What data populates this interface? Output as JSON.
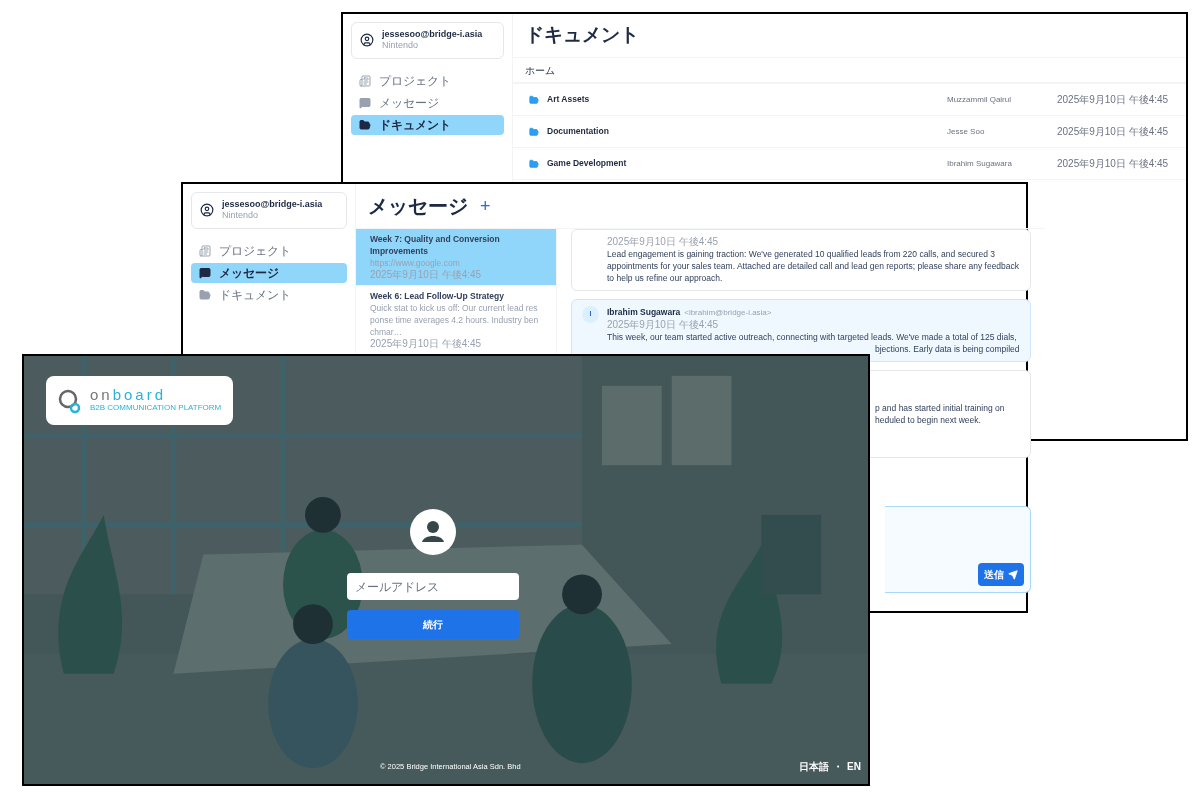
{
  "documents_window": {
    "user": {
      "email": "jessesoo@bridge-i.asia",
      "org": "Nintendo"
    },
    "nav": [
      {
        "label": "プロジェクト",
        "kind": "projects",
        "selected": false
      },
      {
        "label": "メッセージ",
        "kind": "messages",
        "selected": false
      },
      {
        "label": "ドキュメント",
        "kind": "documents",
        "selected": true
      }
    ],
    "title": "ドキュメント",
    "breadcrumb": "ホーム",
    "folders": [
      {
        "name": "Art Assets",
        "owner": "Muzzammil Qairul",
        "date": "2025年9月10日 午後4:45"
      },
      {
        "name": "Documentation",
        "owner": "Jesse Soo",
        "date": "2025年9月10日 午後4:45"
      },
      {
        "name": "Game Development",
        "owner": "Ibrahim Sugawara",
        "date": "2025年9月10日 午後4:45"
      }
    ]
  },
  "messages_window": {
    "user": {
      "email": "jessesoo@bridge-i.asia",
      "org": "Nintendo"
    },
    "nav": [
      {
        "label": "プロジェクト",
        "kind": "projects",
        "selected": false
      },
      {
        "label": "メッセージ",
        "kind": "messages",
        "selected": true
      },
      {
        "label": "ドキュメント",
        "kind": "documents",
        "selected": false
      }
    ],
    "title": "メッセージ",
    "add_button": "+",
    "threads": [
      {
        "title": "Week 7: Quality and Conversion Improvements",
        "preview": "https://www.google.com",
        "date": "2025年9月10日 午後4:45",
        "selected": true
      },
      {
        "title": "Week 6: Lead Follow-Up Strategy",
        "preview": "Quick stat to kick us off: Our current lead response time averages 4.2 hours. Industry benchmar…",
        "date": "2025年9月10日 午後4:45",
        "selected": false
      }
    ],
    "messages": [
      {
        "highlighted": false,
        "date": "2025年9月10日 午後4:45",
        "lines": [
          {
            "kind": "full",
            "text": "Lead engagement is gaining traction: We've generated 10 qualified leads from 220 calls, and secured 3 appointments for your sales team. Attached are detailed call and lead gen reports; please share any feedback to help us refine our approach."
          }
        ]
      },
      {
        "highlighted": true,
        "avatar": "I",
        "author": "Ibrahim Sugawara",
        "email": "<ibrahim@bridge-i.asia>",
        "date": "2025年9月10日 午後4:45",
        "lines": [
          {
            "kind": "full",
            "text": "This week, our team started active outreach, connecting with targeted leads. We've made a total of 125 dials,"
          },
          {
            "kind": "fragment",
            "text": "bjections. Early data is being compiled"
          }
        ]
      },
      {
        "highlighted": false,
        "lines": [
          {
            "kind": "fragment",
            "text": "p and has started initial training on"
          },
          {
            "kind": "fragment",
            "text": "heduled to begin next week."
          }
        ]
      }
    ],
    "send_button": "送信"
  },
  "login_window": {
    "logo": {
      "first": "on",
      "second": "board",
      "tagline": "B2B COMMUNICATION PLATFORM"
    },
    "email_placeholder": "メールアドレス",
    "continue_button": "続行",
    "copyright": "© 2025 Bridge International Asia Sdn. Bhd",
    "languages": [
      {
        "label": "日本語"
      },
      {
        "label": "EN"
      }
    ],
    "language_separator": "・"
  }
}
